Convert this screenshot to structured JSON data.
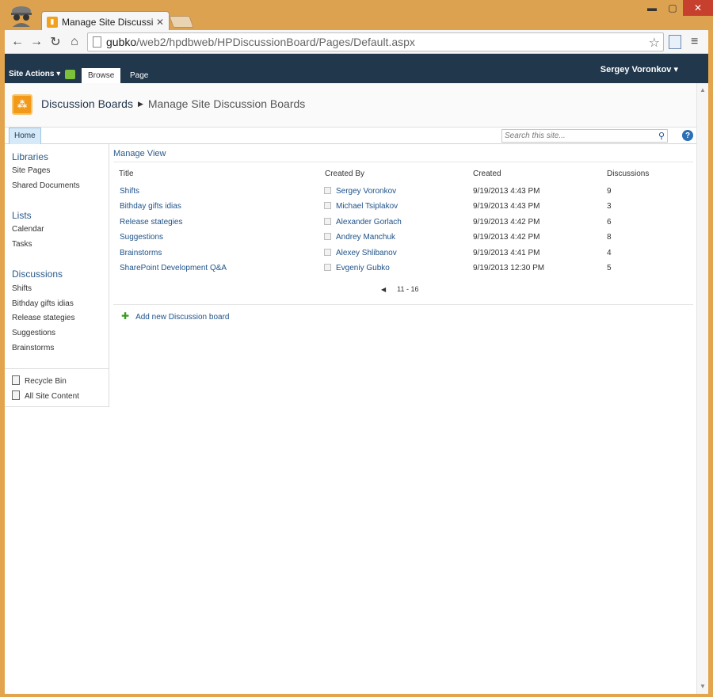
{
  "browser": {
    "tab_title": "Manage Site Discussion Bo",
    "url_host": "gubko",
    "url_path": "/web2/hpdbweb/HPDiscussionBoard/Pages/Default.aspx"
  },
  "ribbon": {
    "site_actions": "Site Actions ▾",
    "tab_browse": "Browse",
    "tab_page": "Page",
    "user_menu": "Sergey Voronkov ▾"
  },
  "header": {
    "breadcrumb_root": "Discussion Boards",
    "breadcrumb_current": "Manage Site Discussion Boards"
  },
  "topnav": {
    "home": "Home",
    "search_placeholder": "Search this site..."
  },
  "sidebar": {
    "libraries_heading": "Libraries",
    "libraries": [
      "Site Pages",
      "Shared Documents"
    ],
    "lists_heading": "Lists",
    "lists": [
      "Calendar",
      "Tasks"
    ],
    "discussions_heading": "Discussions",
    "discussions": [
      "Shifts",
      "Bithday gifts idias",
      "Release stategies",
      "Suggestions",
      "Brainstorms"
    ],
    "recycle_bin": "Recycle Bin",
    "all_site_content": "All Site Content"
  },
  "main": {
    "manage_view": "Manage View",
    "columns": [
      "Title",
      "Created By",
      "Created",
      "Discussions"
    ],
    "rows": [
      {
        "title": "Shifts",
        "created_by": "Sergey Voronkov",
        "created": "9/19/2013 4:43 PM",
        "discussions": "9"
      },
      {
        "title": "Bithday gifts idias",
        "created_by": "Michael Tsiplakov",
        "created": "9/19/2013 4:43 PM",
        "discussions": "3"
      },
      {
        "title": "Release stategies",
        "created_by": "Alexander Gorlach",
        "created": "9/19/2013 4:42 PM",
        "discussions": "6"
      },
      {
        "title": "Suggestions",
        "created_by": "Andrey Manchuk",
        "created": "9/19/2013 4:42 PM",
        "discussions": "8"
      },
      {
        "title": "Brainstorms",
        "created_by": "Alexey Shlibanov",
        "created": "9/19/2013 4:41 PM",
        "discussions": "4"
      },
      {
        "title": "SharePoint Development Q&A",
        "created_by": "Evgeniy Gubko",
        "created": "9/19/2013 12:30 PM",
        "discussions": "5"
      }
    ],
    "paging": "11 - 16",
    "add_new": "Add new Discussion board"
  }
}
